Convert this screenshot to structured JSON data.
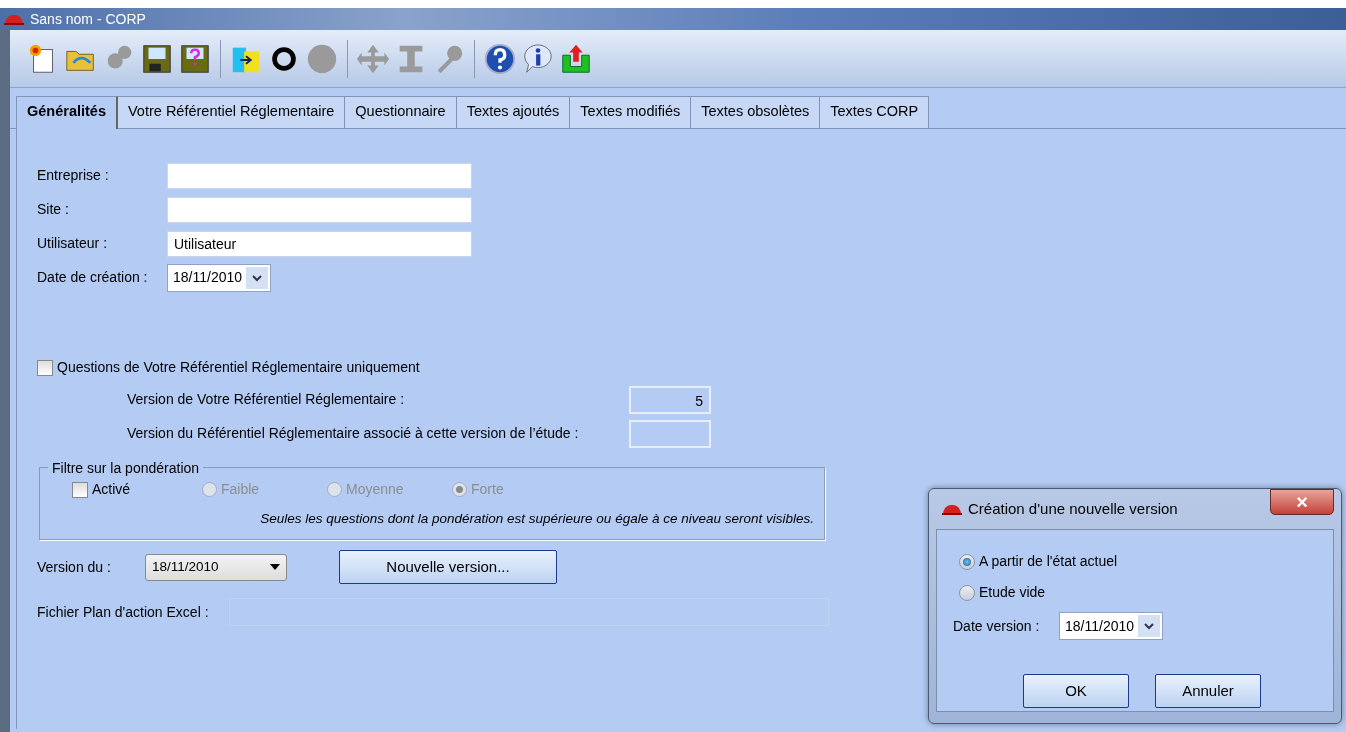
{
  "window": {
    "title": "Sans nom - CORP"
  },
  "toolbar": {
    "groups": [
      [
        {
          "disabled": false
        },
        {
          "disabled": false
        },
        {
          "disabled": true
        },
        {
          "disabled": false
        },
        {
          "disabled": false
        }
      ],
      [
        {
          "disabled": false
        },
        {
          "disabled": false
        },
        {
          "disabled": true
        }
      ],
      [
        {
          "disabled": true
        },
        {
          "disabled": true
        },
        {
          "disabled": true
        }
      ],
      [
        {
          "disabled": false
        },
        {
          "disabled": false
        },
        {
          "disabled": false
        }
      ]
    ]
  },
  "tabs": [
    {
      "label": "Généralités",
      "selected": true
    },
    {
      "label": "Votre Référentiel Réglementaire",
      "selected": false
    },
    {
      "label": "Questionnaire",
      "selected": false
    },
    {
      "label": "Textes ajoutés",
      "selected": false
    },
    {
      "label": "Textes modifiés",
      "selected": false
    },
    {
      "label": "Textes obsolètes",
      "selected": false
    },
    {
      "label": "Textes CORP",
      "selected": false
    }
  ],
  "fields": [
    {
      "kind": "text",
      "label": "Entreprise :"
    },
    {
      "kind": "text",
      "label": "Site :"
    },
    {
      "kind": "text",
      "label": "Utilisateur :",
      "value": "Utilisateur"
    },
    {
      "kind": "date",
      "label": "Date de création :",
      "value": "18/11/2010"
    }
  ],
  "only_questions": {
    "label": "Questions de Votre Référentiel Réglementaire uniquement",
    "checked": false
  },
  "versions": [
    {
      "label": "Version de Votre Référentiel Réglementaire :",
      "value": "5"
    },
    {
      "label": "Version du Référentiel Réglementaire associé à cette version de l’étude :"
    }
  ],
  "filter": {
    "title": "Filtre sur la pondération",
    "active": {
      "label": "Activé",
      "checked": false
    },
    "options": [
      {
        "label": "Faible",
        "selected": false,
        "disabled": true
      },
      {
        "label": "Moyenne",
        "selected": false,
        "disabled": true
      },
      {
        "label": "Forte",
        "selected": true,
        "disabled": true
      }
    ],
    "note": "Seules les questions dont la pondération est supérieure ou égale à ce niveau seront visibles."
  },
  "version_du": {
    "label": "Version du :",
    "value": "18/11/2010"
  },
  "new_version_button": "Nouvelle version...",
  "excel": {
    "label": "Fichier Plan d'action Excel :"
  },
  "dialog": {
    "title": "Création d'une nouvelle version",
    "close": "×",
    "options": [
      {
        "label": "A partir de l'état actuel",
        "selected": true
      },
      {
        "label": "Etude vide",
        "selected": false
      }
    ],
    "date": {
      "label": "Date version :",
      "value": "18/11/2010"
    },
    "buttons": [
      "OK",
      "Annuler"
    ]
  }
}
